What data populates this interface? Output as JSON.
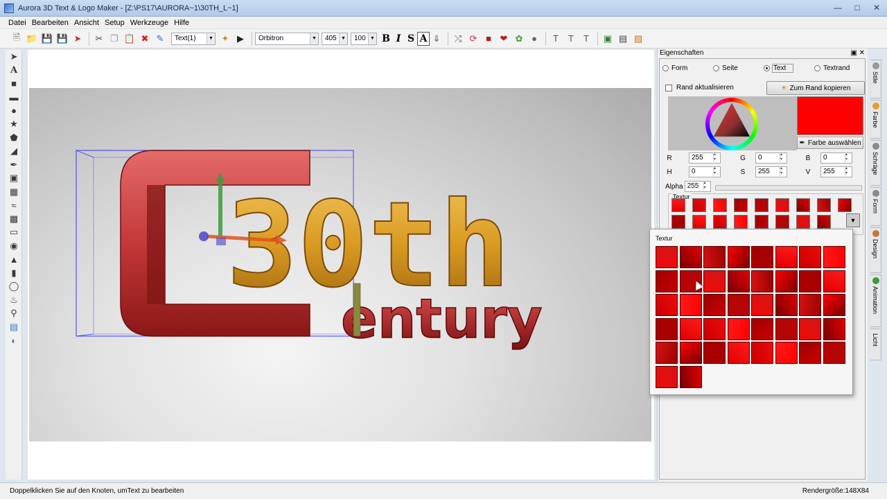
{
  "window": {
    "title": "Aurora 3D Text & Logo Maker - [Z:\\PS17\\AURORA~1\\30TH_L~1]"
  },
  "menu": [
    "Datei",
    "Bearbeiten",
    "Ansicht",
    "Setup",
    "Werkzeuge",
    "Hilfe"
  ],
  "toolbar": {
    "object_select": "Text(1)",
    "font": "Orbitron",
    "size1": "405",
    "size2": "100",
    "bold": "B",
    "italic": "I",
    "strike": "S",
    "shadow": "A"
  },
  "canvas": {
    "logo_letter": "C",
    "logo_main": "30th",
    "logo_sub": "entury"
  },
  "properties": {
    "title": "Eigenschaften",
    "radios": [
      {
        "label": "Form",
        "selected": false
      },
      {
        "label": "Seite",
        "selected": false
      },
      {
        "label": "Text",
        "selected": true
      },
      {
        "label": "Textrand",
        "selected": false
      }
    ],
    "update_border_label": "Rand aktualisieren",
    "copy_to_border_label": "Zum Rand kopieren",
    "pick_color_label": "Farbe auswählen",
    "swatch_color": "#ff0000",
    "fields_row1": [
      {
        "label": "R",
        "value": "255"
      },
      {
        "label": "G",
        "value": "0"
      },
      {
        "label": "B",
        "value": "0"
      }
    ],
    "fields_row2": [
      {
        "label": "H",
        "value": "0"
      },
      {
        "label": "S",
        "value": "255"
      },
      {
        "label": "V",
        "value": "255"
      }
    ],
    "alpha_label": "Alpha",
    "alpha_value": "255",
    "texture_label": "Textur"
  },
  "side_tabs": [
    "Stile",
    "Farbe",
    "Schräge",
    "Form",
    "Design",
    "Animation",
    "Licht"
  ],
  "texture_popup": {
    "label": "Textur"
  },
  "status": {
    "hint": "Doppelklicken Sie auf den Knoten, umText zu bearbeiten",
    "render_size": "Rendergröße:148X84"
  }
}
